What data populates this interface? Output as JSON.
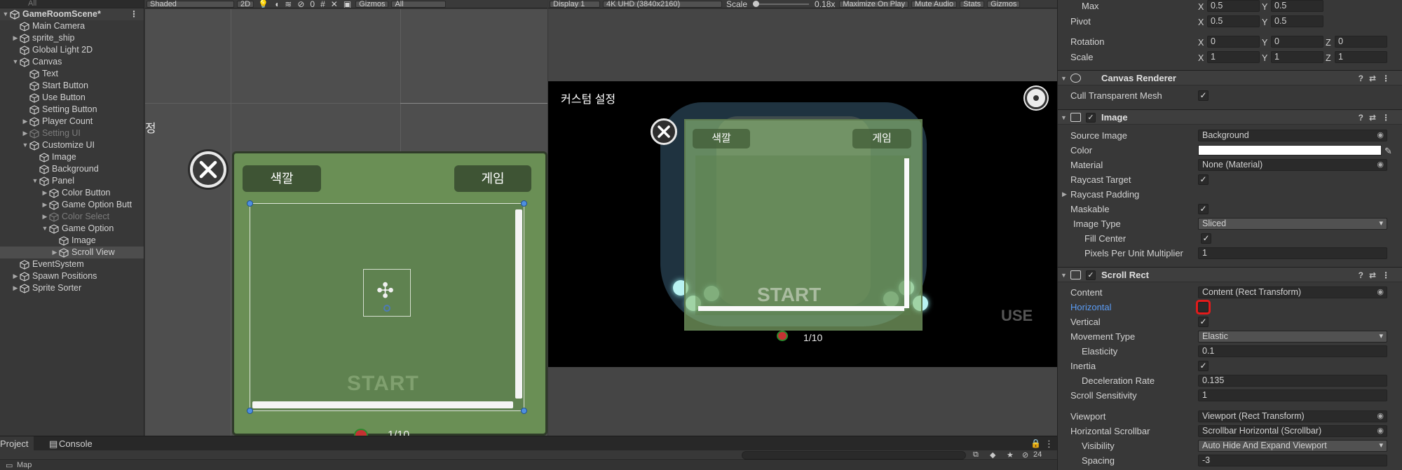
{
  "hierarchy": {
    "search_placeholder": "All",
    "scene_name": "GameRoomScene*",
    "items": [
      {
        "label": "Main Camera",
        "indent": 1,
        "arrow": ""
      },
      {
        "label": "sprite_ship",
        "indent": 1,
        "arrow": "▶"
      },
      {
        "label": "Global Light 2D",
        "indent": 1,
        "arrow": ""
      },
      {
        "label": "Canvas",
        "indent": 1,
        "arrow": "▼"
      },
      {
        "label": "Text",
        "indent": 2,
        "arrow": ""
      },
      {
        "label": "Start Button",
        "indent": 2,
        "arrow": ""
      },
      {
        "label": "Use Button",
        "indent": 2,
        "arrow": ""
      },
      {
        "label": "Setting Button",
        "indent": 2,
        "arrow": ""
      },
      {
        "label": "Player Count",
        "indent": 2,
        "arrow": "▶"
      },
      {
        "label": "Setting UI",
        "indent": 2,
        "arrow": "▶",
        "dim": true
      },
      {
        "label": "Customize UI",
        "indent": 2,
        "arrow": "▼"
      },
      {
        "label": "Image",
        "indent": 3,
        "arrow": ""
      },
      {
        "label": "Background",
        "indent": 3,
        "arrow": ""
      },
      {
        "label": "Panel",
        "indent": 3,
        "arrow": "▼"
      },
      {
        "label": "Color Button",
        "indent": 4,
        "arrow": "▶"
      },
      {
        "label": "Game Option Butt",
        "indent": 4,
        "arrow": "▶"
      },
      {
        "label": "Color Select",
        "indent": 4,
        "arrow": "▶",
        "dim": true
      },
      {
        "label": "Game Option",
        "indent": 4,
        "arrow": "▼"
      },
      {
        "label": "Image",
        "indent": 5,
        "arrow": ""
      },
      {
        "label": "Scroll View",
        "indent": 5,
        "arrow": "▶",
        "selected": true
      },
      {
        "label": "EventSystem",
        "indent": 1,
        "arrow": ""
      },
      {
        "label": "Spawn Positions",
        "indent": 1,
        "arrow": "▶"
      },
      {
        "label": "Sprite Sorter",
        "indent": 1,
        "arrow": "▶"
      }
    ]
  },
  "scene_toolbar": {
    "shading": "Shaded",
    "mode_2d": "2D",
    "hidden_count": "0",
    "gizmos": "Gizmos",
    "search_placeholder": "All"
  },
  "scene_view": {
    "side_char": "정",
    "tab_color": "색깔",
    "tab_game": "게임",
    "start_ghost": "START",
    "page_counter": "1/10"
  },
  "game_toolbar": {
    "display": "Display 1",
    "resolution": "4K UHD (3840x2160)",
    "scale_label": "Scale",
    "scale_value": "0.18x",
    "maximize": "Maximize On Play",
    "mute": "Mute Audio",
    "stats": "Stats",
    "gizmos": "Gizmos"
  },
  "game_view": {
    "title": "커스텀 설정",
    "tab_color": "색깔",
    "tab_game": "게임",
    "start_ghost": "START",
    "page_counter": "1/10",
    "use_ghost": "USE"
  },
  "inspector": {
    "max_label": "Max",
    "max_x": "0.5",
    "max_y": "0.5",
    "pivot_label": "Pivot",
    "pivot_x": "0.5",
    "pivot_y": "0.5",
    "rotation_label": "Rotation",
    "rot_x": "0",
    "rot_y": "0",
    "rot_z": "0",
    "scale_label": "Scale",
    "scale_x": "1",
    "scale_y": "1",
    "scale_z": "1",
    "canvas_renderer": {
      "title": "Canvas Renderer",
      "cull_label": "Cull Transparent Mesh",
      "cull_checked": true
    },
    "image": {
      "title": "Image",
      "source_image_label": "Source Image",
      "source_image_value": "Background",
      "color_label": "Color",
      "color_value": "#ffffff",
      "material_label": "Material",
      "material_value": "None (Material)",
      "raycast_target_label": "Raycast Target",
      "raycast_padding_label": "Raycast Padding",
      "maskable_label": "Maskable",
      "image_type_label": "Image Type",
      "image_type_value": "Sliced",
      "fill_center_label": "Fill Center",
      "ppu_label": "Pixels Per Unit Multiplier",
      "ppu_value": "1"
    },
    "scroll_rect": {
      "title": "Scroll Rect",
      "content_label": "Content",
      "content_value": "Content (Rect Transform)",
      "horizontal_label": "Horizontal",
      "horizontal_checked": false,
      "vertical_label": "Vertical",
      "vertical_checked": true,
      "movement_type_label": "Movement Type",
      "movement_type_value": "Elastic",
      "elasticity_label": "Elasticity",
      "elasticity_value": "0.1",
      "inertia_label": "Inertia",
      "deceleration_label": "Deceleration Rate",
      "deceleration_value": "0.135",
      "scroll_sensitivity_label": "Scroll Sensitivity",
      "scroll_sensitivity_value": "1",
      "viewport_label": "Viewport",
      "viewport_value": "Viewport (Rect Transform)",
      "hscrollbar_label": "Horizontal Scrollbar",
      "hscrollbar_value": "Scrollbar Horizontal (Scrollbar)",
      "visibility_label": "Visibility",
      "visibility_value": "Auto Hide And Expand Viewport",
      "spacing_label": "Spacing",
      "spacing_value": "-3"
    }
  },
  "bottom": {
    "tab_project": "Project",
    "tab_console": "Console",
    "hidden_count": "24",
    "folder_label": "Map"
  },
  "colors": {
    "selection_outline": "#e31b1b",
    "link_blue": "#5b9cf4",
    "panel_green": "#6a8f55"
  }
}
